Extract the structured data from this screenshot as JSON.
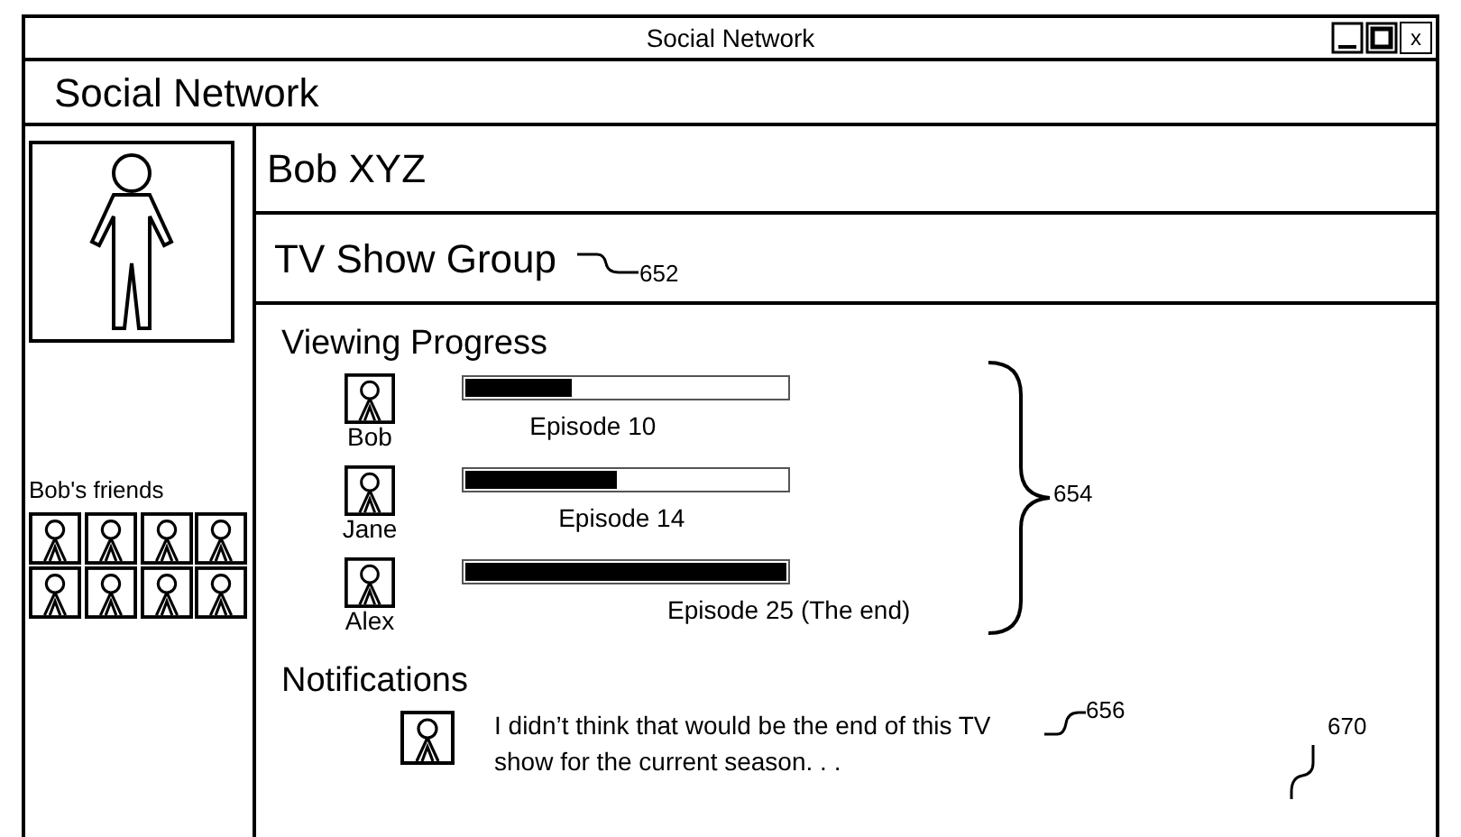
{
  "window": {
    "title": "Social Network",
    "close_label": "x"
  },
  "app_title": "Social Network",
  "profile": {
    "name": "Bob XYZ",
    "friends_label": "Bob's friends",
    "friends": [
      {
        "kind": "avatar"
      },
      {
        "kind": "avatar"
      },
      {
        "kind": "avatar"
      },
      {
        "kind": "avatar"
      },
      {
        "kind": "avatar"
      },
      {
        "kind": "avatar"
      },
      {
        "kind": "avatar"
      },
      {
        "kind": "avatar"
      }
    ]
  },
  "group": {
    "title": "TV Show Group",
    "ref": "652"
  },
  "progress": {
    "title": "Viewing Progress",
    "ref": "654",
    "members": [
      {
        "name": "Bob",
        "level": 0.33,
        "episode": "Episode 10"
      },
      {
        "name": "Jane",
        "level": 0.47,
        "episode": "Episode 14"
      },
      {
        "name": "Alex",
        "level": 1.0,
        "episode": "Episode 25 (The end)"
      }
    ]
  },
  "notifications": {
    "title": "Notifications",
    "ref": "670",
    "items": [
      {
        "text": "I didn’t think that would be the end of this TV show for the current season. . .",
        "ref": "656"
      }
    ]
  }
}
